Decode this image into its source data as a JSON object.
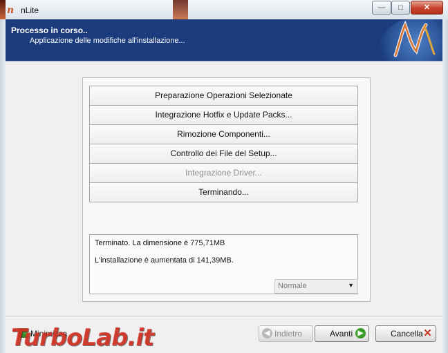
{
  "window": {
    "title": "nLite",
    "minimize_glyph": "—",
    "maximize_glyph": "□",
    "close_glyph": "✕"
  },
  "header": {
    "title": "Processo in corso..",
    "subtitle": "Applicazione delle modifiche all'installazione..."
  },
  "tasks": [
    {
      "label": "Preparazione Operazioni Selezionate",
      "enabled": true
    },
    {
      "label": "Integrazione Hotfix e Update Packs...",
      "enabled": true
    },
    {
      "label": "Rimozione Componenti...",
      "enabled": true
    },
    {
      "label": "Controllo dei File del Setup...",
      "enabled": true
    },
    {
      "label": "Integrazione Driver...",
      "enabled": false
    },
    {
      "label": "Terminando...",
      "enabled": true
    }
  ],
  "log": {
    "lines": [
      "Terminato. La dimensione è 775,71MB",
      "L'installazione è aumentata di 141,39MB."
    ]
  },
  "priority_select": {
    "value": "Normale",
    "arrow": "▼"
  },
  "footer": {
    "minimize_label": "Minimizza",
    "back_label": "Indietro",
    "back_glyph": "◀",
    "next_label": "Avanti",
    "next_glyph": "▶",
    "cancel_label": "Cancella",
    "cancel_glyph": "✕"
  },
  "watermark": "TurboLab.it",
  "colors": {
    "header_bg": "#1c3b7c",
    "next_icon": "#3a9b2a",
    "cancel_icon": "#c8301e",
    "watermark": "#d73223"
  }
}
